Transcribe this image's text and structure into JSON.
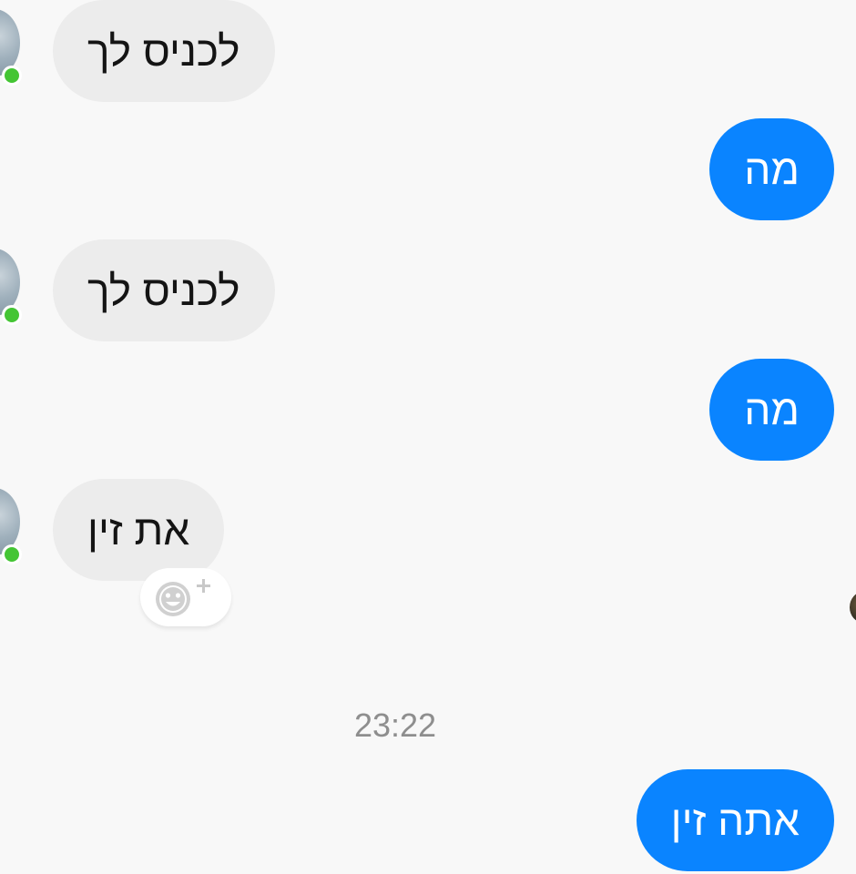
{
  "conversation": {
    "messages": [
      {
        "direction": "incoming",
        "text": "לכניס לך"
      },
      {
        "direction": "outgoing",
        "text": "מה"
      },
      {
        "direction": "incoming",
        "text": "לכניס לך"
      },
      {
        "direction": "outgoing",
        "text": "מה"
      },
      {
        "direction": "incoming",
        "text": "את זין"
      },
      {
        "direction": "outgoing",
        "text": "אתה זין"
      }
    ],
    "timestamp": "23:22",
    "reaction_button_icon": "add-reaction-smiley-icon"
  },
  "colors": {
    "background": "#f8f8f8",
    "incoming_bubble": "#ececec",
    "outgoing_bubble": "#0a84ff",
    "presence_online": "#44c534",
    "timestamp_text": "#8e8e8e"
  }
}
